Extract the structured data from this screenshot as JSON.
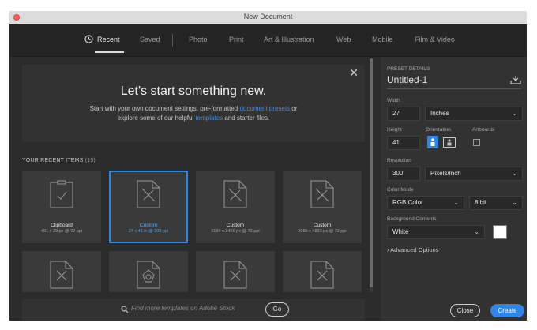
{
  "window": {
    "title": "New Document"
  },
  "nav": {
    "tabs": [
      {
        "label": "Recent"
      },
      {
        "label": "Saved"
      },
      {
        "label": "Photo"
      },
      {
        "label": "Print"
      },
      {
        "label": "Art & Illustration"
      },
      {
        "label": "Web"
      },
      {
        "label": "Mobile"
      },
      {
        "label": "Film & Video"
      }
    ],
    "active_tab": "Recent"
  },
  "hero": {
    "close_glyph": "✕",
    "title": "Let's start something new.",
    "line1_pre": "Start with your own document settings, pre-formatted ",
    "line1_link": "document presets",
    "line1_post": " or",
    "line2_pre": "explore some of our helpful ",
    "line2_link": "templates",
    "line2_post": " and starter files."
  },
  "recent": {
    "label": "YOUR RECENT ITEMS",
    "count": "(15)",
    "items": [
      {
        "name": "Clipboard",
        "dims": "451 x 29 px @ 72 ppi",
        "icon": "clipboard-check-icon"
      },
      {
        "name": "Custom",
        "dims": "27 x 41 in @ 300 ppi",
        "icon": "custom-document-icon",
        "selected": true
      },
      {
        "name": "Custom",
        "dims": "5184 x 3456 px @ 72 ppi",
        "icon": "custom-document-icon"
      },
      {
        "name": "Custom",
        "dims": "3055 x 4833 px @ 72 ppi",
        "icon": "custom-document-icon"
      }
    ]
  },
  "search": {
    "placeholder": "Find more templates on Adobe Stock",
    "go_label": "Go"
  },
  "preset": {
    "section_label": "PRESET DETAILS",
    "doc_name": "Untitled-1",
    "width_label": "Width",
    "width_value": "27",
    "width_unit": "Inches",
    "height_label": "Height",
    "height_value": "41",
    "orientation_label": "Orientation",
    "artboards_label": "Artboards",
    "resolution_label": "Resolution",
    "resolution_value": "300",
    "resolution_unit": "Pixels/Inch",
    "color_mode_label": "Color Mode",
    "color_mode_value": "RGB Color",
    "bit_depth_value": "8 bit",
    "background_label": "Background Contents",
    "background_value": "White",
    "background_swatch": "#ffffff",
    "advanced_label": "Advanced Options",
    "close_label": "Close",
    "create_label": "Create"
  },
  "colors": {
    "accent": "#2f86e8",
    "panel": "#2b2b2b",
    "sidebar": "#323232"
  }
}
